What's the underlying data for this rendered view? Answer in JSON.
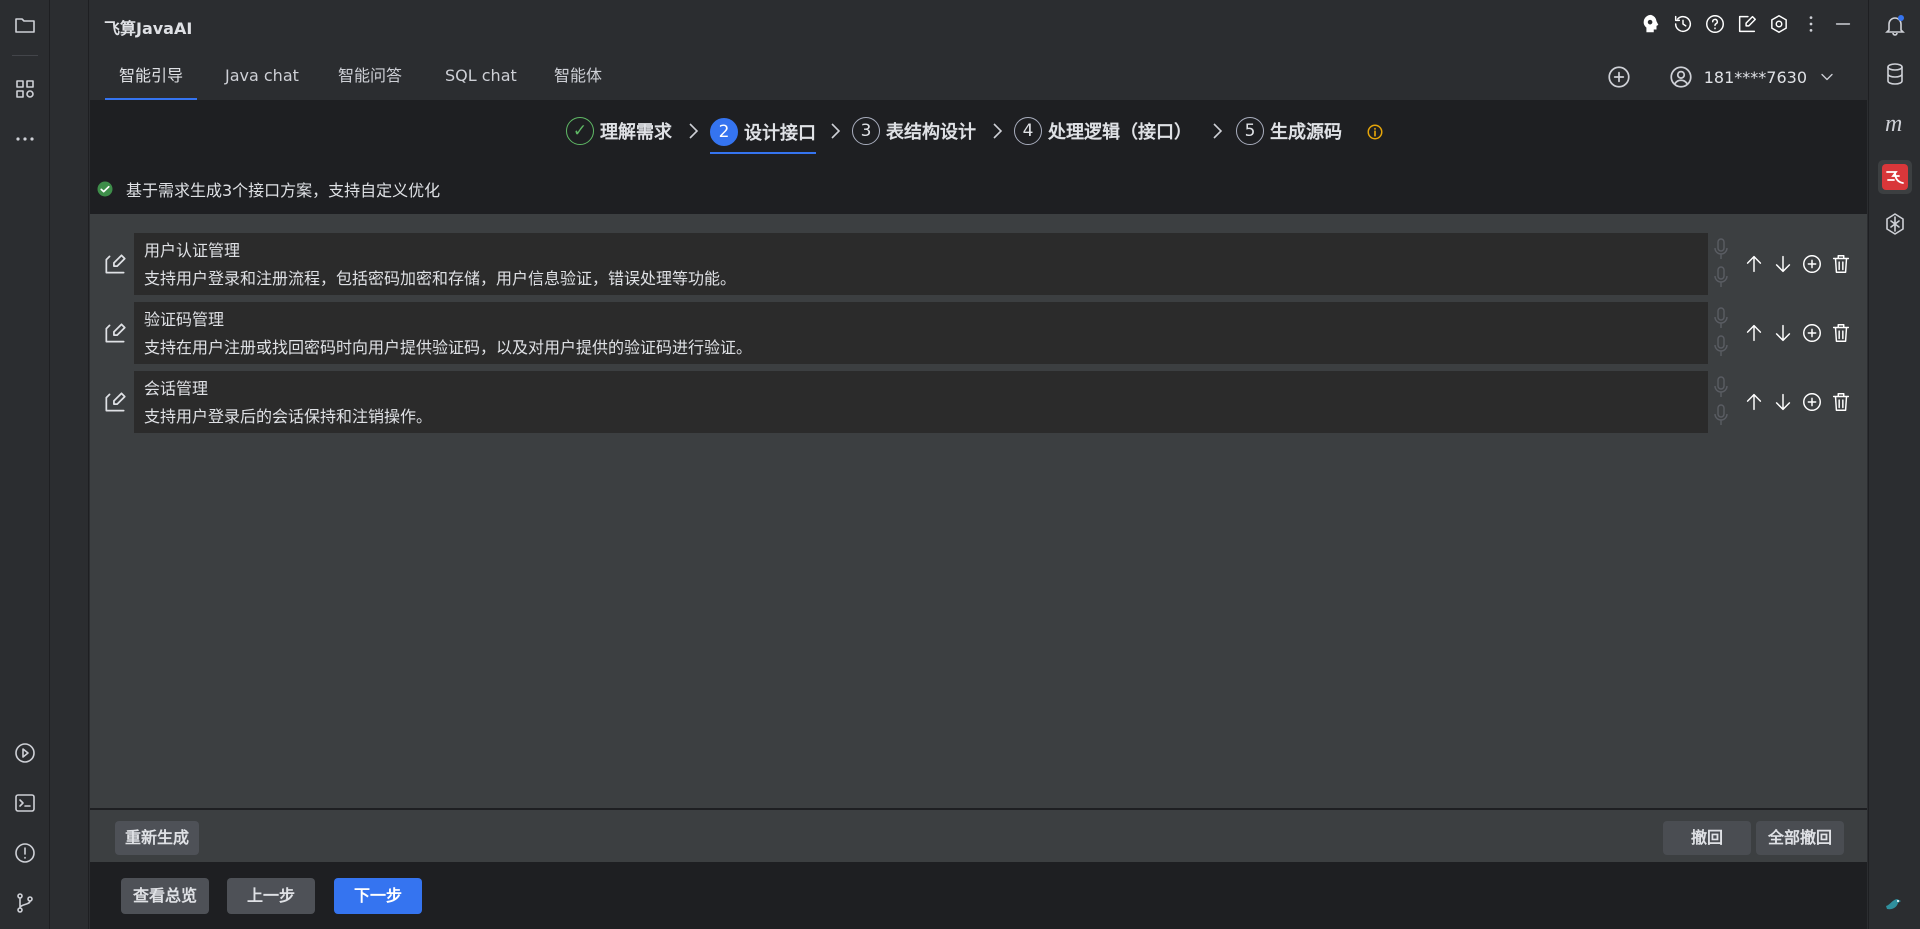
{
  "app_title": "飞算JavaAI",
  "tabs": [
    {
      "label": "智能引导",
      "active": true
    },
    {
      "label": "Java chat",
      "active": false
    },
    {
      "label": "智能问答",
      "active": false
    },
    {
      "label": "SQL chat",
      "active": false
    },
    {
      "label": "智能体",
      "active": false
    }
  ],
  "account": {
    "user": "181****7630"
  },
  "steps": [
    {
      "num": "✓",
      "label": "理解需求",
      "state": "done"
    },
    {
      "num": "2",
      "label": "设计接口",
      "state": "current"
    },
    {
      "num": "3",
      "label": "表结构设计",
      "state": "pending"
    },
    {
      "num": "4",
      "label": "处理逻辑（接口）",
      "state": "pending"
    },
    {
      "num": "5",
      "label": "生成源码",
      "state": "pending"
    }
  ],
  "notice": "基于需求生成3个接口方案，支持自定义优化",
  "interfaces": [
    {
      "title": "用户认证管理",
      "desc": "支持用户登录和注册流程，包括密码加密和存储，用户信息验证，错误处理等功能。"
    },
    {
      "title": "验证码管理",
      "desc": "支持在用户注册或找回密码时向用户提供验证码，以及对用户提供的验证码进行验证。"
    },
    {
      "title": "会话管理",
      "desc": "支持用户登录后的会话保持和注销操作。"
    }
  ],
  "buttons": {
    "regenerate": "重新生成",
    "undo": "撤回",
    "undo_all": "全部撤回",
    "overview": "查看总览",
    "prev": "上一步",
    "next": "下一步"
  },
  "colors": {
    "accent": "#3574f0",
    "success": "#5fb865",
    "warning": "#e5a50a",
    "brand_red": "#d9373a"
  }
}
